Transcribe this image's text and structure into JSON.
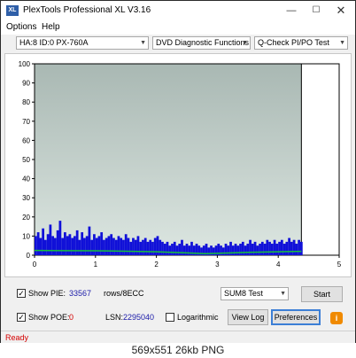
{
  "window": {
    "title": "PlexTools Professional XL V3.16",
    "icon_label": "XL",
    "controls": {
      "minimize": "—",
      "maximize": "☐",
      "close": "✕"
    }
  },
  "menu": {
    "options": "Options",
    "help": "Help"
  },
  "toolbar": {
    "drive": "HA:8 ID:0  PX-760A",
    "function": "DVD Diagnostic Functions",
    "test": "Q-Check PI/PO Test"
  },
  "chart_data": {
    "type": "area",
    "xlim": [
      0,
      5
    ],
    "ylim": [
      0,
      100
    ],
    "x_ticks": [
      "0",
      "1",
      "2",
      "3",
      "4",
      "5"
    ],
    "y_ticks": [
      "0",
      "10",
      "20",
      "30",
      "40",
      "50",
      "60",
      "70",
      "80",
      "90",
      "100"
    ],
    "grid": false,
    "data_end_x": 4.38,
    "colors": {
      "plot_top": "#a9b8b3",
      "plot_bottom": "#dce6e1",
      "bars": "#1010d8",
      "line": "#16c13c"
    },
    "series": [
      {
        "kind": "bars",
        "x_step": 0.04,
        "values": [
          10,
          12,
          9,
          14,
          8,
          11,
          16,
          10,
          9,
          13,
          18,
          9,
          12,
          10,
          11,
          9,
          10,
          13,
          8,
          12,
          9,
          10,
          15,
          8,
          11,
          9,
          10,
          12,
          8,
          9,
          10,
          11,
          9,
          8,
          10,
          9,
          8,
          11,
          9,
          7,
          9,
          8,
          10,
          7,
          8,
          9,
          7,
          8,
          7,
          9,
          10,
          8,
          7,
          6,
          7,
          5,
          6,
          7,
          5,
          6,
          8,
          5,
          6,
          5,
          7,
          5,
          6,
          5,
          4,
          5,
          6,
          4,
          5,
          4,
          5,
          6,
          5,
          4,
          6,
          5,
          7,
          5,
          6,
          5,
          6,
          7,
          5,
          6,
          8,
          6,
          7,
          5,
          6,
          7,
          6,
          8,
          7,
          6,
          8,
          6,
          7,
          8,
          6,
          7,
          9,
          7,
          8,
          6,
          8,
          7
        ]
      },
      {
        "kind": "line",
        "x": [
          0,
          0.5,
          1,
          1.5,
          2,
          2.5,
          2.8,
          3.0,
          3.5,
          4,
          4.38
        ],
        "values": [
          2.5,
          2.4,
          2.3,
          2.1,
          1.8,
          1.2,
          0.8,
          1.0,
          1.5,
          1.8,
          2.0
        ]
      }
    ]
  },
  "controls": {
    "show_pie_label": "Show PIE:",
    "pie_value": "33567",
    "pie_unit": "rows/8ECC",
    "show_poe_label": "Show POE:",
    "poe_value": "0",
    "lsn_label": "LSN:",
    "lsn_value": "2295040",
    "logarithmic_label": "Logarithmic",
    "sum_select": "SUM8 Test",
    "start_label": "Start",
    "view_log_label": "View Log",
    "preferences_label": "Preferences",
    "info_label": "i",
    "check_mark": "✓"
  },
  "status": {
    "text": "Ready"
  },
  "caption": "569x551  26kb PNG"
}
